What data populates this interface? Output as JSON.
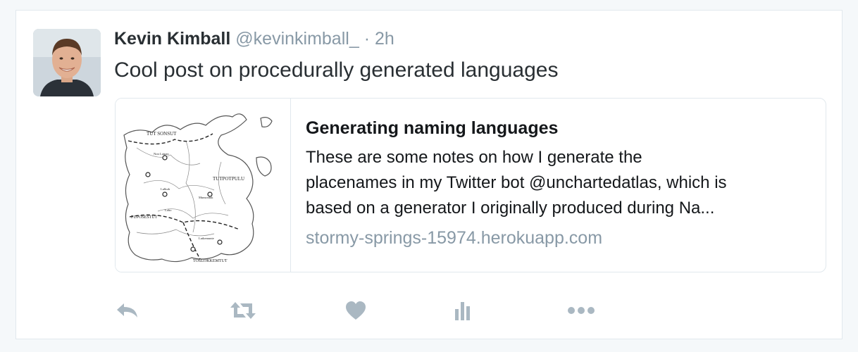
{
  "tweet": {
    "fullname": "Kevin Kimball",
    "username": "@kevinkimball_",
    "separator": "·",
    "time": "2h",
    "text": "Cool post on procedurally generated languages"
  },
  "card": {
    "title": "Generating naming languages",
    "description_lines": [
      "These are some notes on how I generate the",
      "placenames in my Twitter bot @unchartedatlas, which is",
      "based on a generator I originally produced during Na..."
    ],
    "domain": "stormy-springs-15974.herokuapp.com",
    "map_labels": [
      "TUT SONSUT",
      "TUTPOTPULU",
      "PUPOSESTUT",
      "TOSLOKKEMTUT",
      "Lutkemunte",
      "Lulkuh",
      "Lobo",
      "Non Lutpan",
      "Munsontuk"
    ]
  },
  "actions": {
    "icons": [
      "reply-icon",
      "retweet-icon",
      "like-icon",
      "analytics-icon",
      "more-icon"
    ],
    "icon_color": "#aab8c2"
  },
  "colors": {
    "background": "#f5f8fa",
    "border": "#e1e8ed",
    "text_primary": "#292f33",
    "text_secondary": "#8899a6"
  }
}
